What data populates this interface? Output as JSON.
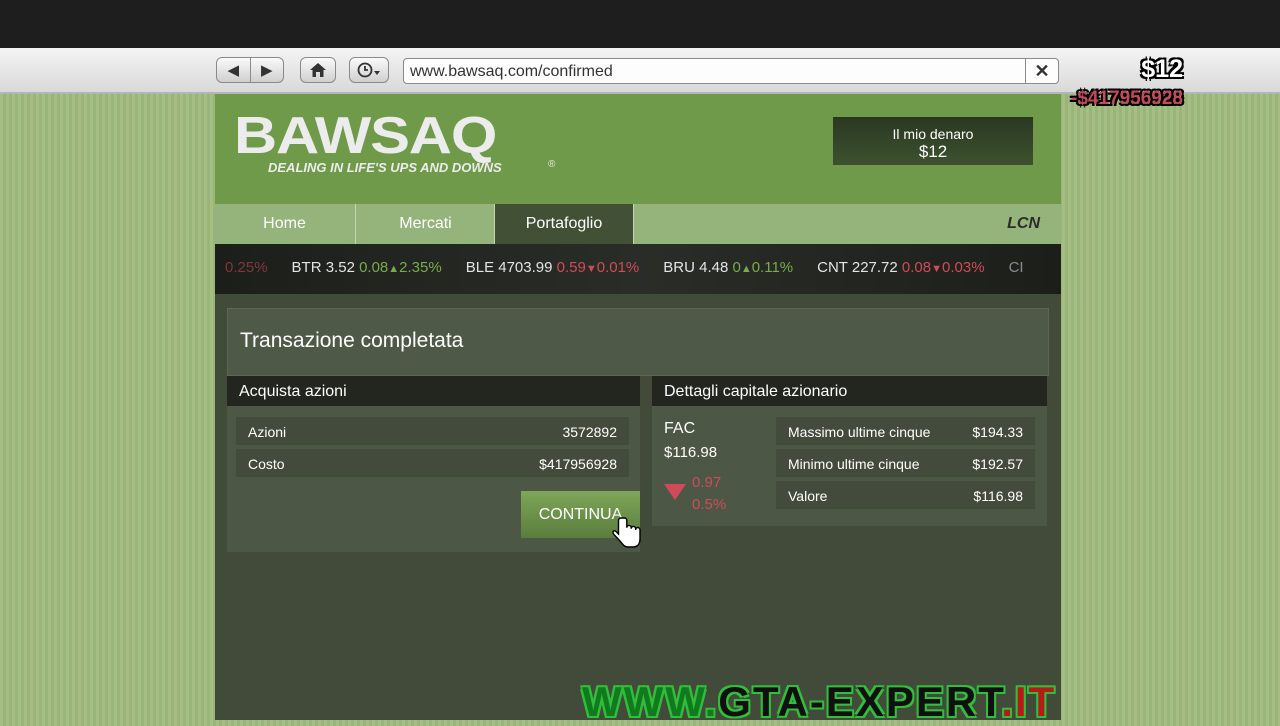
{
  "browser": {
    "url": "www.bawsaq.com/confirmed",
    "icons": {
      "back": "back-arrow-icon",
      "forward": "forward-arrow-icon",
      "home": "home-icon",
      "history": "history-clock-icon",
      "close": "close-icon"
    }
  },
  "hud": {
    "money": "$12",
    "delta": "-$417956928"
  },
  "site": {
    "logo": "BAWSAQ",
    "slogan": "DEALING IN LIFE'S UPS AND DOWNS",
    "reg_mark": "®",
    "my_money_label": "Il mio denaro",
    "my_money_value": "$12"
  },
  "nav": {
    "tabs": [
      {
        "label": "Home"
      },
      {
        "label": "Mercati"
      },
      {
        "label": "Portafoglio"
      }
    ],
    "active_tab": "Portafoglio",
    "partner_logo": "LCN"
  },
  "ticker": [
    {
      "text": "0.25%",
      "status": "neg"
    },
    {
      "symbol": "BTR",
      "price": "3.52",
      "change": "0.08",
      "direction": "up",
      "percent": "2.35%"
    },
    {
      "symbol": "BLE",
      "price": "4703.99",
      "change": "0.59",
      "direction": "down",
      "percent": "0.01%"
    },
    {
      "symbol": "BRU",
      "price": "4.48",
      "change": "0",
      "direction": "up",
      "percent": "0.11%"
    },
    {
      "symbol": "CNT",
      "price": "227.72",
      "change": "0.08",
      "direction": "down",
      "percent": "0.03%"
    },
    {
      "text": "CI",
      "status": "fade"
    }
  ],
  "page": {
    "title": "Transazione completata"
  },
  "buy_panel": {
    "title": "Acquista azioni",
    "rows": [
      {
        "label": "Azioni",
        "value": "3572892"
      },
      {
        "label": "Costo",
        "value": "$417956928"
      }
    ],
    "continue_label": "CONTINUA"
  },
  "details_panel": {
    "title": "Dettagli capitale azionario",
    "symbol": "FAC",
    "price": "$116.98",
    "change": "0.97",
    "percent": "0.5%",
    "direction": "down",
    "rows": [
      {
        "label": "Massimo ultime cinque",
        "value": "$194.33"
      },
      {
        "label": "Minimo ultime cinque",
        "value": "$192.57"
      },
      {
        "label": "Valore",
        "value": "$116.98"
      }
    ]
  },
  "colors": {
    "up": "#7aaa4f",
    "down": "#d04a5a",
    "header_green": "#6f9a49",
    "nav_active": "#425136"
  },
  "watermark": {
    "www": "WWW.",
    "domain": "GTA-EXPERT",
    "tld": ".IT"
  }
}
